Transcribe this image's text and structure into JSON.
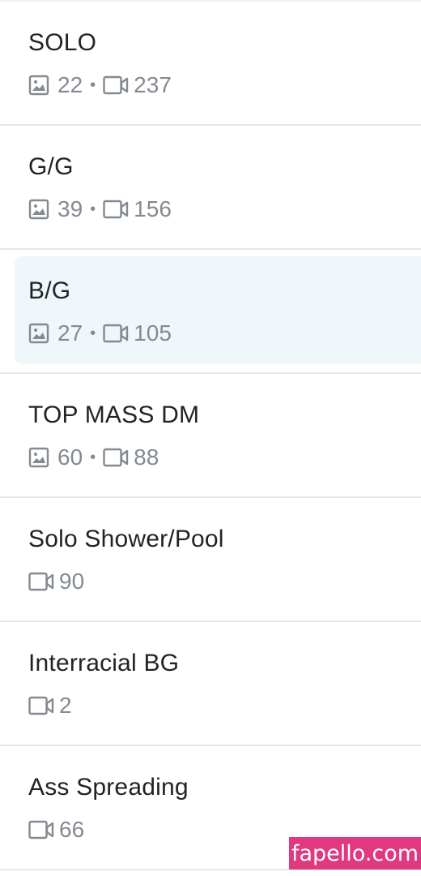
{
  "colors": {
    "accent_selected_bg": "#eff7fb",
    "meta_gray": "#848a91",
    "watermark_bg": "#e0397f"
  },
  "icons": {
    "photo": "image-icon",
    "video": "video-camera-icon"
  },
  "lists": [
    {
      "title": "SOLO",
      "photos": "22",
      "videos": "237",
      "selected": false
    },
    {
      "title": "G/G",
      "photos": "39",
      "videos": "156",
      "selected": false
    },
    {
      "title": "B/G",
      "photos": "27",
      "videos": "105",
      "selected": true
    },
    {
      "title": "TOP MASS DM",
      "photos": "60",
      "videos": "88",
      "selected": false
    },
    {
      "title": "Solo Shower/Pool",
      "photos": null,
      "videos": "90",
      "selected": false
    },
    {
      "title": "Interracial BG",
      "photos": null,
      "videos": "2",
      "selected": false
    },
    {
      "title": "Ass Spreading",
      "photos": null,
      "videos": "66",
      "selected": false
    }
  ],
  "separator": "•",
  "watermark": "fapello.com"
}
